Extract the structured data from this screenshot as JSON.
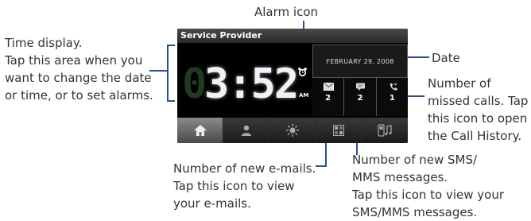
{
  "phone": {
    "provider": "Service Provider",
    "time": "3:52",
    "ghost_digit": "0",
    "ampm": "AM",
    "date": "FEBRUARY 29, 2008",
    "notifications": {
      "email_count": "2",
      "sms_count": "2",
      "missed_calls_count": "1"
    },
    "tabs": [
      "home-icon",
      "contacts-icon",
      "weather-icon",
      "programs-icon",
      "music-icon"
    ]
  },
  "callouts": {
    "alarm": "Alarm icon",
    "time_display": [
      "Time display.",
      "Tap this area when you",
      "want to change the date",
      "or time, or to set alarms."
    ],
    "date": "Date",
    "missed_calls": [
      "Number of",
      "missed calls. Tap",
      "this icon to open",
      "the Call History."
    ],
    "emails": [
      "Number of new e-mails.",
      "Tap this icon to view",
      "your e-mails."
    ],
    "sms": [
      "Number of new SMS/",
      "MMS messages.",
      "Tap this icon to view your",
      "SMS/MMS messages."
    ]
  },
  "colors": {
    "leader_line": "#2b4f8e",
    "panel": "#000000"
  }
}
